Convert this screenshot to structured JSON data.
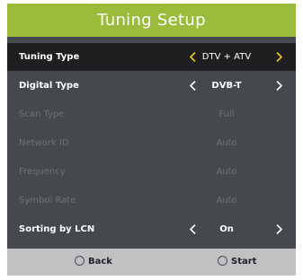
{
  "title": "Tuning Setup",
  "rows": [
    {
      "label": "Tuning Type",
      "value": "DTV + ATV"
    },
    {
      "label": "Digital Type",
      "value": "DVB-T"
    },
    {
      "label": "Scan Type",
      "value": "Full"
    },
    {
      "label": "Network ID",
      "value": "Auto"
    },
    {
      "label": "Frequency",
      "value": "Auto"
    },
    {
      "label": "Symbol Rate",
      "value": "Auto"
    },
    {
      "label": "Sorting by LCN",
      "value": "On"
    }
  ],
  "footer": {
    "back_label": "Back",
    "start_label": "Start"
  },
  "colors": {
    "accent": "#9bbb3b",
    "arrow_active": "#f2c81e",
    "panel": "#45484c"
  }
}
